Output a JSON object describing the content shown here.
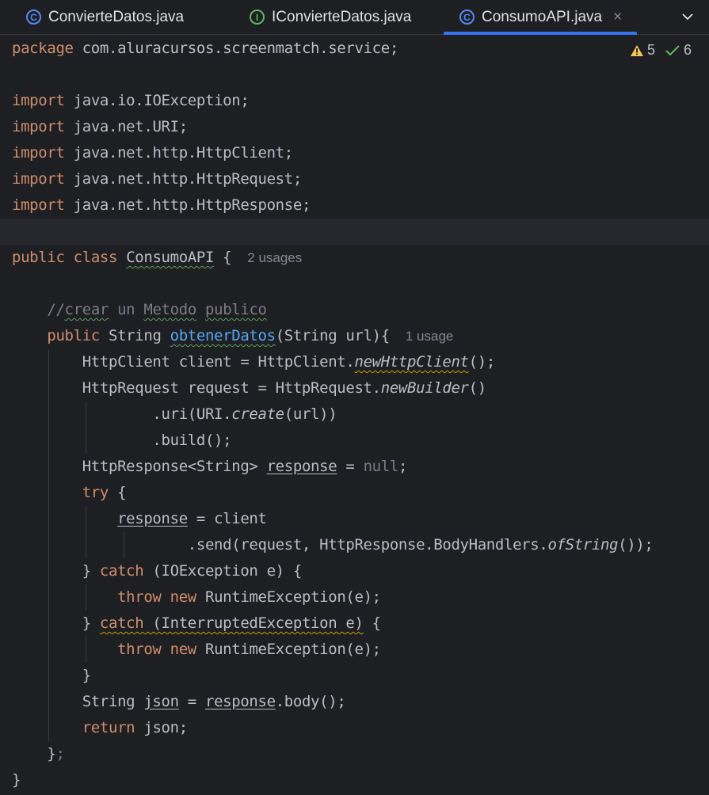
{
  "tabs": [
    {
      "label": "ConvierteDatos.java",
      "icon": "class-icon"
    },
    {
      "label": "IConvierteDatos.java",
      "icon": "interface-icon"
    },
    {
      "label": "ConsumoAPI.java",
      "icon": "class-icon",
      "active": true
    }
  ],
  "inspections": {
    "warnings": "5",
    "ok": "6"
  },
  "code": {
    "package_kw": "package",
    "package_name": "com.aluracursos.screenmatch.service;",
    "import_kw": "import",
    "imports": [
      "java.io.IOException;",
      "java.net.URI;",
      "java.net.http.HttpClient;",
      "java.net.http.HttpRequest;",
      "java.net.http.HttpResponse;"
    ],
    "class_usages": "2 usages",
    "method_usages": "1 usage",
    "comment_slash": "//",
    "comment_words": [
      "crear",
      "un",
      "Metodo",
      "publico"
    ]
  },
  "colors": {
    "background": "#1e1f22",
    "keyword": "#cf8e6d",
    "method": "#56a8f5",
    "comment": "#7a7e85",
    "accent": "#3574f0"
  }
}
